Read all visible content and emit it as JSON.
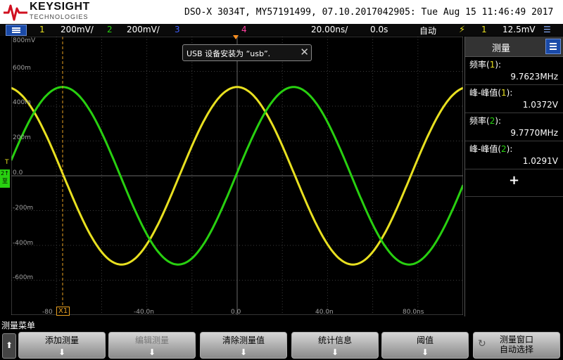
{
  "header": {
    "brand": "KEYSIGHT",
    "brand_sub": "TECHNOLOGIES",
    "title": "DSO-X 3034T, MY57191499, 07.10.2017042905: Tue Aug 15 11:46:49 2017"
  },
  "status": {
    "ch1_num": "1",
    "ch1_scale": "200mV/",
    "ch2_num": "2",
    "ch2_scale": "200mV/",
    "ch3_num": "3",
    "ch4_num": "4",
    "timebase": "20.00ns/",
    "delay": "0.0s",
    "trigger_mode": "自动",
    "trigger_source": "1",
    "trigger_level": "12.5mV"
  },
  "grid": {
    "levels": [
      "800mV",
      "600m",
      "400m",
      "200m",
      "0.0",
      "-200m",
      "-400m",
      "-600m"
    ],
    "time_labels": [
      "-80",
      "-40.0n",
      "0.0",
      "40.0n",
      "80.0ns"
    ],
    "cursor_label": "X1",
    "trigger_marker": "T",
    "ch_marker": "2↑",
    "ch_marker_sub": "至"
  },
  "toast": {
    "message": "USB 设备安装为 “usb”.",
    "close_icon": "close-icon"
  },
  "panel": {
    "title": "测量",
    "measurements": [
      {
        "label_pre": "频率(",
        "ch": "1",
        "label_post": "):",
        "value": "9.7623MHz"
      },
      {
        "label_pre": "峰-峰值(",
        "ch": "1",
        "label_post": "):",
        "value": "1.0372V"
      },
      {
        "label_pre": "频率(",
        "ch": "2",
        "label_post": "):",
        "value": "9.7770MHz"
      },
      {
        "label_pre": "峰-峰值(",
        "ch": "2",
        "label_post": "):",
        "value": "1.0291V"
      }
    ],
    "add_label": "+"
  },
  "softkeys": {
    "menu_title": "测量菜单",
    "back": "⬆",
    "add": "添加测量",
    "edit": "编辑测量",
    "clear": "清除测量值",
    "stats": "统计信息",
    "threshold": "阈值",
    "window_line1": "测量窗口",
    "window_line2": "自动选择"
  },
  "chart_data": {
    "type": "line",
    "xlabel": "",
    "ylabel": "",
    "x_range_ns": [
      -100,
      100
    ],
    "y_range_mV": [
      -800,
      800
    ],
    "series": [
      {
        "name": "1",
        "color": "#e8e020",
        "frequency_MHz": 9.7623,
        "vpp_V": 1.0372,
        "amplitude_mV": 510,
        "peak_time_ns": 0
      },
      {
        "name": "2",
        "color": "#28d010",
        "frequency_MHz": 9.777,
        "vpp_V": 1.0291,
        "amplitude_mV": 510,
        "peak_time_ns": 25
      }
    ],
    "grid": true
  }
}
